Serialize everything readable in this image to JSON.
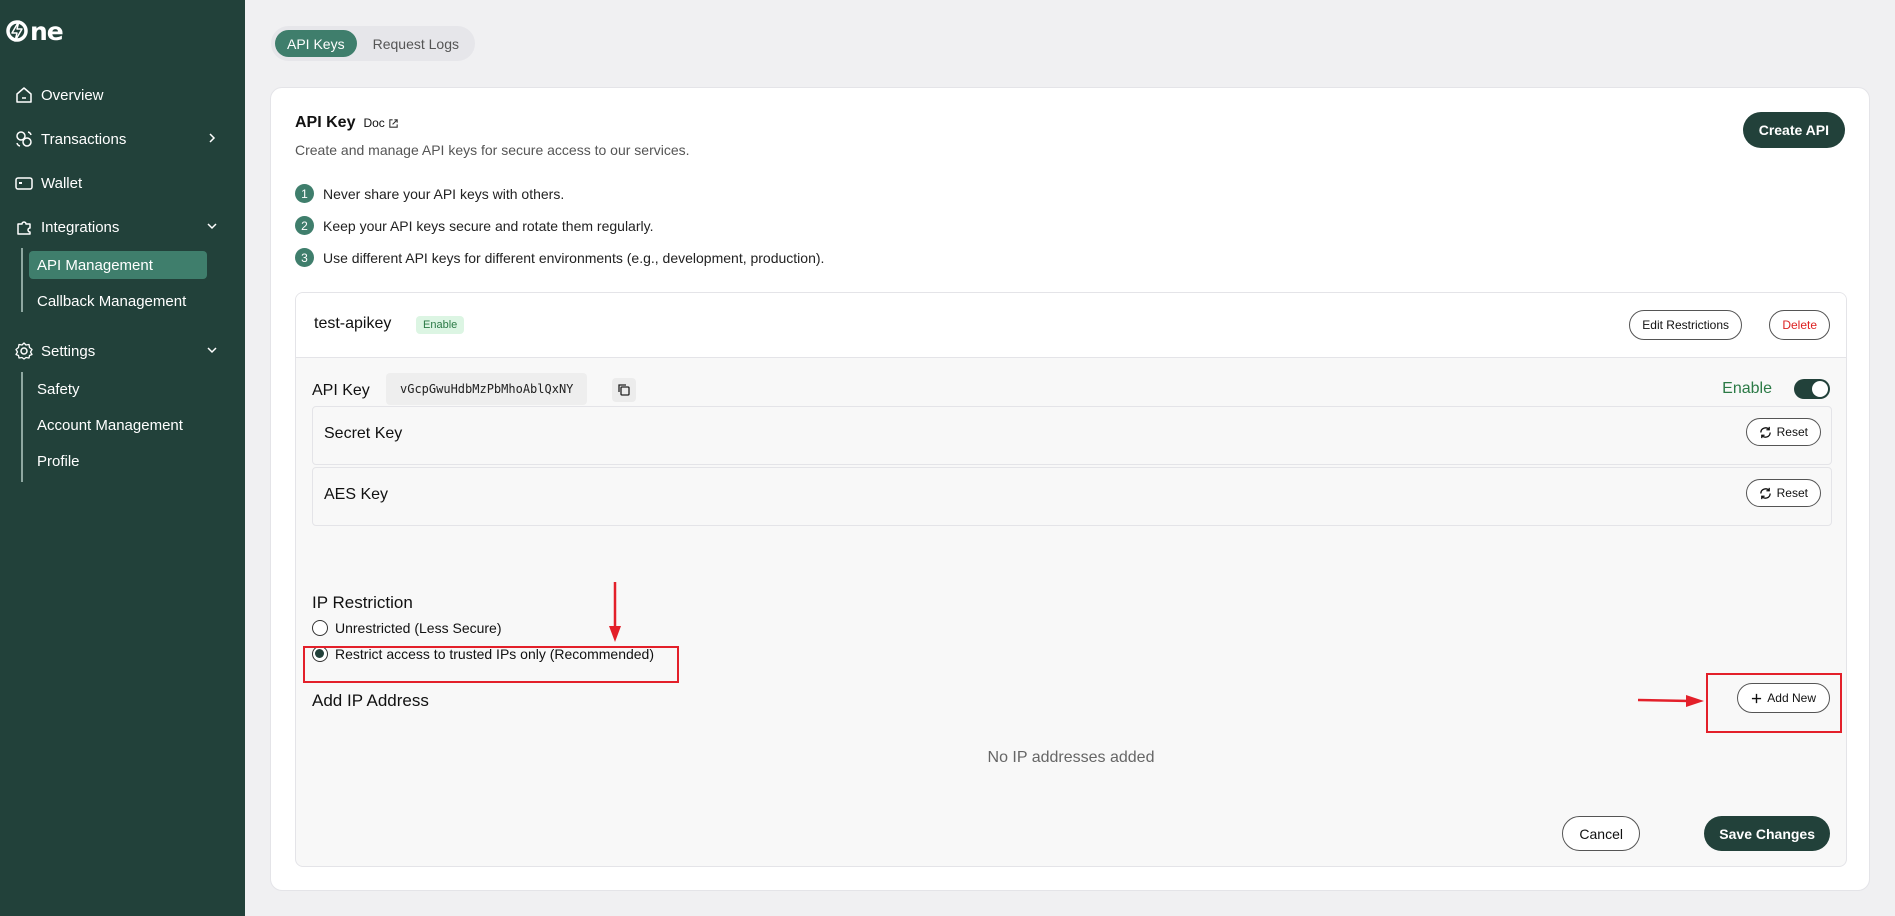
{
  "brand": {
    "logo_text": "ne"
  },
  "sidebar": {
    "items": [
      {
        "label": "Overview"
      },
      {
        "label": "Transactions"
      },
      {
        "label": "Wallet"
      },
      {
        "label": "Integrations"
      },
      {
        "label": "Settings"
      }
    ],
    "integrations_sub": [
      {
        "label": "API Management",
        "active": true
      },
      {
        "label": "Callback Management"
      }
    ],
    "settings_sub": [
      {
        "label": "Safety"
      },
      {
        "label": "Account Management"
      },
      {
        "label": "Profile"
      }
    ]
  },
  "tabs": [
    {
      "label": "API Keys",
      "active": true
    },
    {
      "label": "Request Logs"
    }
  ],
  "header": {
    "title": "API Key",
    "doc_label": "Doc",
    "subtitle": "Create and manage API keys for secure access to our services.",
    "create_button": "Create API"
  },
  "tips": [
    {
      "num": "1",
      "text": "Never share your API keys with others."
    },
    {
      "num": "2",
      "text": "Keep your API keys secure and rotate them regularly."
    },
    {
      "num": "3",
      "text": "Use different API keys for different environments (e.g., development, production)."
    }
  ],
  "key": {
    "name": "test-apikey",
    "status_badge": "Enable",
    "edit_button": "Edit Restrictions",
    "delete_button": "Delete",
    "api_key_label": "API Key",
    "api_key_value": "vGcpGwuHdbMzPbMhoAblQxNY",
    "enable_label": "Enable",
    "enabled": true,
    "secret_key_label": "Secret Key",
    "aes_key_label": "AES Key",
    "reset_label": "Reset"
  },
  "ip_restriction": {
    "title": "IP Restriction",
    "options": [
      {
        "label": "Unrestricted (Less Secure)",
        "checked": false
      },
      {
        "label": "Restrict access to trusted IPs only (Recommended)",
        "checked": true
      }
    ],
    "add_title": "Add IP Address",
    "add_button": "Add New",
    "empty_message": "No IP addresses added"
  },
  "footer": {
    "cancel": "Cancel",
    "save": "Save Changes"
  },
  "colors": {
    "sidebar_bg": "#22413a",
    "accent": "#3f7e6c",
    "annotation": "#e3202a"
  }
}
